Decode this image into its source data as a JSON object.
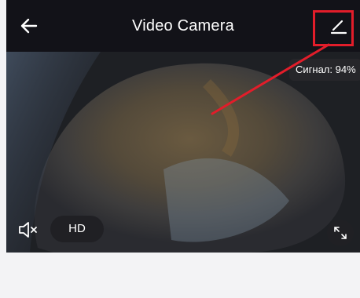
{
  "header": {
    "title": "Video Camera",
    "back_icon": "arrow-left-icon",
    "edit_icon": "pencil-icon"
  },
  "video": {
    "signal_label": "Сигнал: 94%",
    "quality_label": "HD",
    "mute_icon": "speaker-muted-icon",
    "fullscreen_icon": "expand-icon"
  },
  "annotation": {
    "color": "#e21d2a"
  }
}
